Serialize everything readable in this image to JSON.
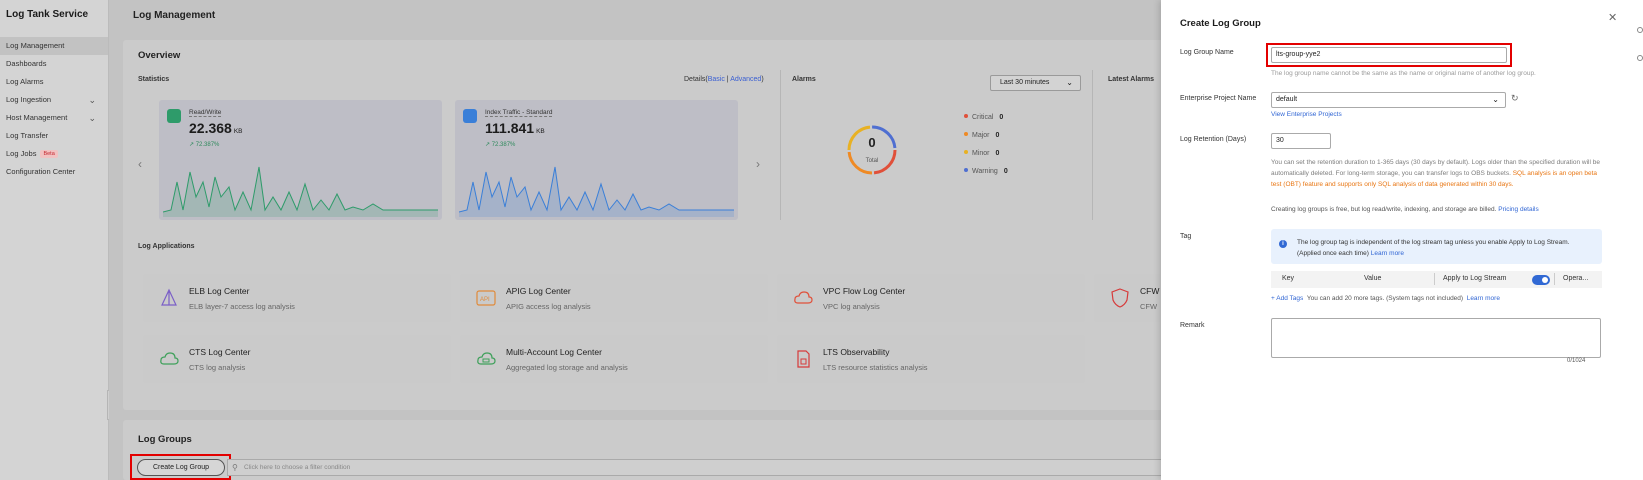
{
  "sidebar": {
    "brand": "Log Tank Service",
    "items": [
      {
        "label": "Log Management",
        "active": true
      },
      {
        "label": "Dashboards"
      },
      {
        "label": "Log Alarms"
      },
      {
        "label": "Log Ingestion",
        "expandable": true
      },
      {
        "label": "Host Management",
        "expandable": true
      },
      {
        "label": "Log Transfer"
      },
      {
        "label": "Log Jobs",
        "badge": "Beta"
      },
      {
        "label": "Configuration Center"
      }
    ]
  },
  "main": {
    "title": "Log Management",
    "overview": {
      "title": "Overview",
      "statistics_label": "Statistics",
      "details_prefix": "Details(",
      "details_basic": "Basic",
      "details_sep": " | ",
      "details_advanced": "Advanced",
      "details_suffix": ")",
      "stats": [
        {
          "label": "Read/Write",
          "value": "22.368",
          "unit": "KB",
          "trend": "72.387%",
          "color": "#2e9b6a"
        },
        {
          "label": "Index Traffic - Standard",
          "value": "111.841",
          "unit": "KB",
          "trend": "72.387%",
          "color": "#3a7fd8"
        }
      ],
      "alarms_label": "Alarms",
      "time_range": "Last 30 minutes",
      "alarm_total": "0",
      "alarm_total_label": "Total",
      "alarm_levels": [
        {
          "label": "Critical",
          "count": "0",
          "color": "#e0503a"
        },
        {
          "label": "Major",
          "count": "0",
          "color": "#ef8a24"
        },
        {
          "label": "Minor",
          "count": "0",
          "color": "#e8b123"
        },
        {
          "label": "Warning",
          "count": "0",
          "color": "#4f6fd1"
        }
      ],
      "latest_alarms_label": "Latest Alarms"
    },
    "log_applications": {
      "title": "Log Applications",
      "apps": [
        {
          "name": "ELB Log Center",
          "desc": "ELB layer-7 access log analysis",
          "icon": "elb-icon"
        },
        {
          "name": "APIG Log Center",
          "desc": "APIG access log analysis",
          "icon": "apig-icon"
        },
        {
          "name": "VPC Flow Log Center",
          "desc": "VPC log analysis",
          "icon": "vpc-cloud-icon"
        },
        {
          "name": "CFW",
          "desc": "CFW",
          "icon": "cfw-shield-icon"
        },
        {
          "name": "CTS Log Center",
          "desc": "CTS log analysis",
          "icon": "cts-cloud-icon"
        },
        {
          "name": "Multi-Account Log Center",
          "desc": "Aggregated log storage and analysis",
          "icon": "multi-account-icon"
        },
        {
          "name": "LTS Observability",
          "desc": "LTS resource statistics analysis",
          "icon": "lts-document-icon"
        }
      ]
    },
    "log_groups": {
      "title": "Log Groups",
      "create_button": "Create Log Group",
      "filter_placeholder": "Click here to choose a filter condition"
    }
  },
  "drawer": {
    "title": "Create Log Group",
    "log_group_name_label": "Log Group Name",
    "log_group_name_value": "lts-group-yye2",
    "log_group_name_hint": "The log group name cannot be the same as the name or original name of another log group.",
    "enterprise_project_label": "Enterprise Project Name",
    "enterprise_project_value": "default",
    "view_enterprise_projects": "View Enterprise Projects",
    "retention_label": "Log Retention (Days)",
    "retention_value": "30",
    "retention_desc": "You can set the retention duration to 1-365 days (30 days by default). Logs older than the specified duration will be automatically deleted. For long-term storage, you can transfer logs to OBS buckets.",
    "retention_warn": "SQL analysis is an open beta test (OBT) feature and supports only SQL analysis of data generated within 30 days.",
    "billing_note": "Creating log groups is free, but log read/write, indexing, and storage are billed.",
    "pricing_details": "Pricing details",
    "tag_label": "Tag",
    "tag_info": "The log group tag is independent of the log stream tag unless you enable Apply to Log Stream. (Applied once each time)",
    "learn_more": "Learn more",
    "tag_columns": {
      "key": "Key",
      "value": "Value",
      "apply": "Apply to Log Stream",
      "operation": "Opera..."
    },
    "add_tags": "+ Add Tags",
    "add_tags_hint": "You can add 20 more tags. (System tags not included)",
    "add_tags_learn_more": "Learn more",
    "remark_label": "Remark",
    "remark_count": "0/1024"
  }
}
